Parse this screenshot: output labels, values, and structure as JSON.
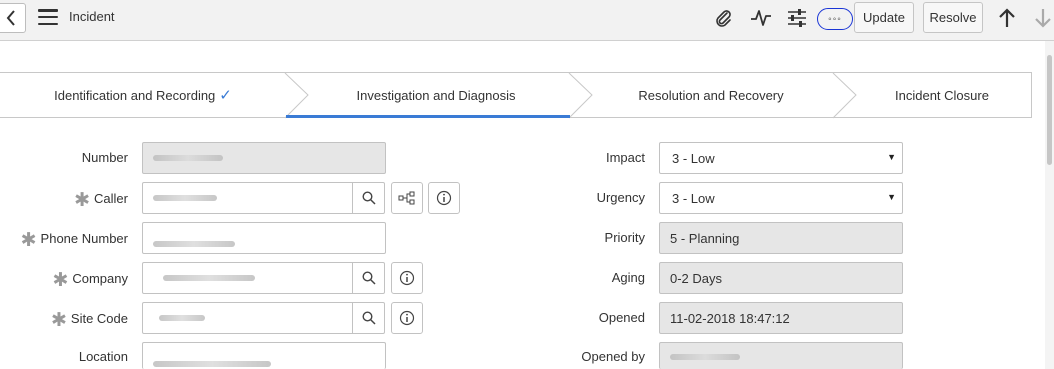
{
  "header": {
    "title": "Incident",
    "update_label": "Update",
    "resolve_label": "Resolve",
    "more_icon": "◦◦◦",
    "highlight_color": "#1a35d6"
  },
  "process_flow": {
    "stages": [
      {
        "label": "Identification and Recording",
        "check": "✓"
      },
      {
        "label": "Investigation and Diagnosis"
      },
      {
        "label": "Resolution and Recovery"
      },
      {
        "label": "Incident Closure"
      }
    ],
    "active_color": "#3a7bd5"
  },
  "form": {
    "left": {
      "number": {
        "label": "Number",
        "value": ""
      },
      "caller": {
        "label": "Caller",
        "value": ""
      },
      "phone": {
        "label": "Phone Number",
        "value": ""
      },
      "company": {
        "label": "Company",
        "value": ""
      },
      "site_code": {
        "label": "Site Code",
        "value": ""
      },
      "location": {
        "label": "Location",
        "value": ""
      }
    },
    "right": {
      "impact": {
        "label": "Impact",
        "value": "3 - Low"
      },
      "urgency": {
        "label": "Urgency",
        "value": "3 - Low"
      },
      "priority": {
        "label": "Priority",
        "value": "5 - Planning"
      },
      "aging": {
        "label": "Aging",
        "value": "0-2 Days"
      },
      "opened": {
        "label": "Opened",
        "value": "11-02-2018 18:47:12"
      },
      "opened_by": {
        "label": "Opened by",
        "value": ""
      }
    },
    "required_marker": "✱"
  }
}
